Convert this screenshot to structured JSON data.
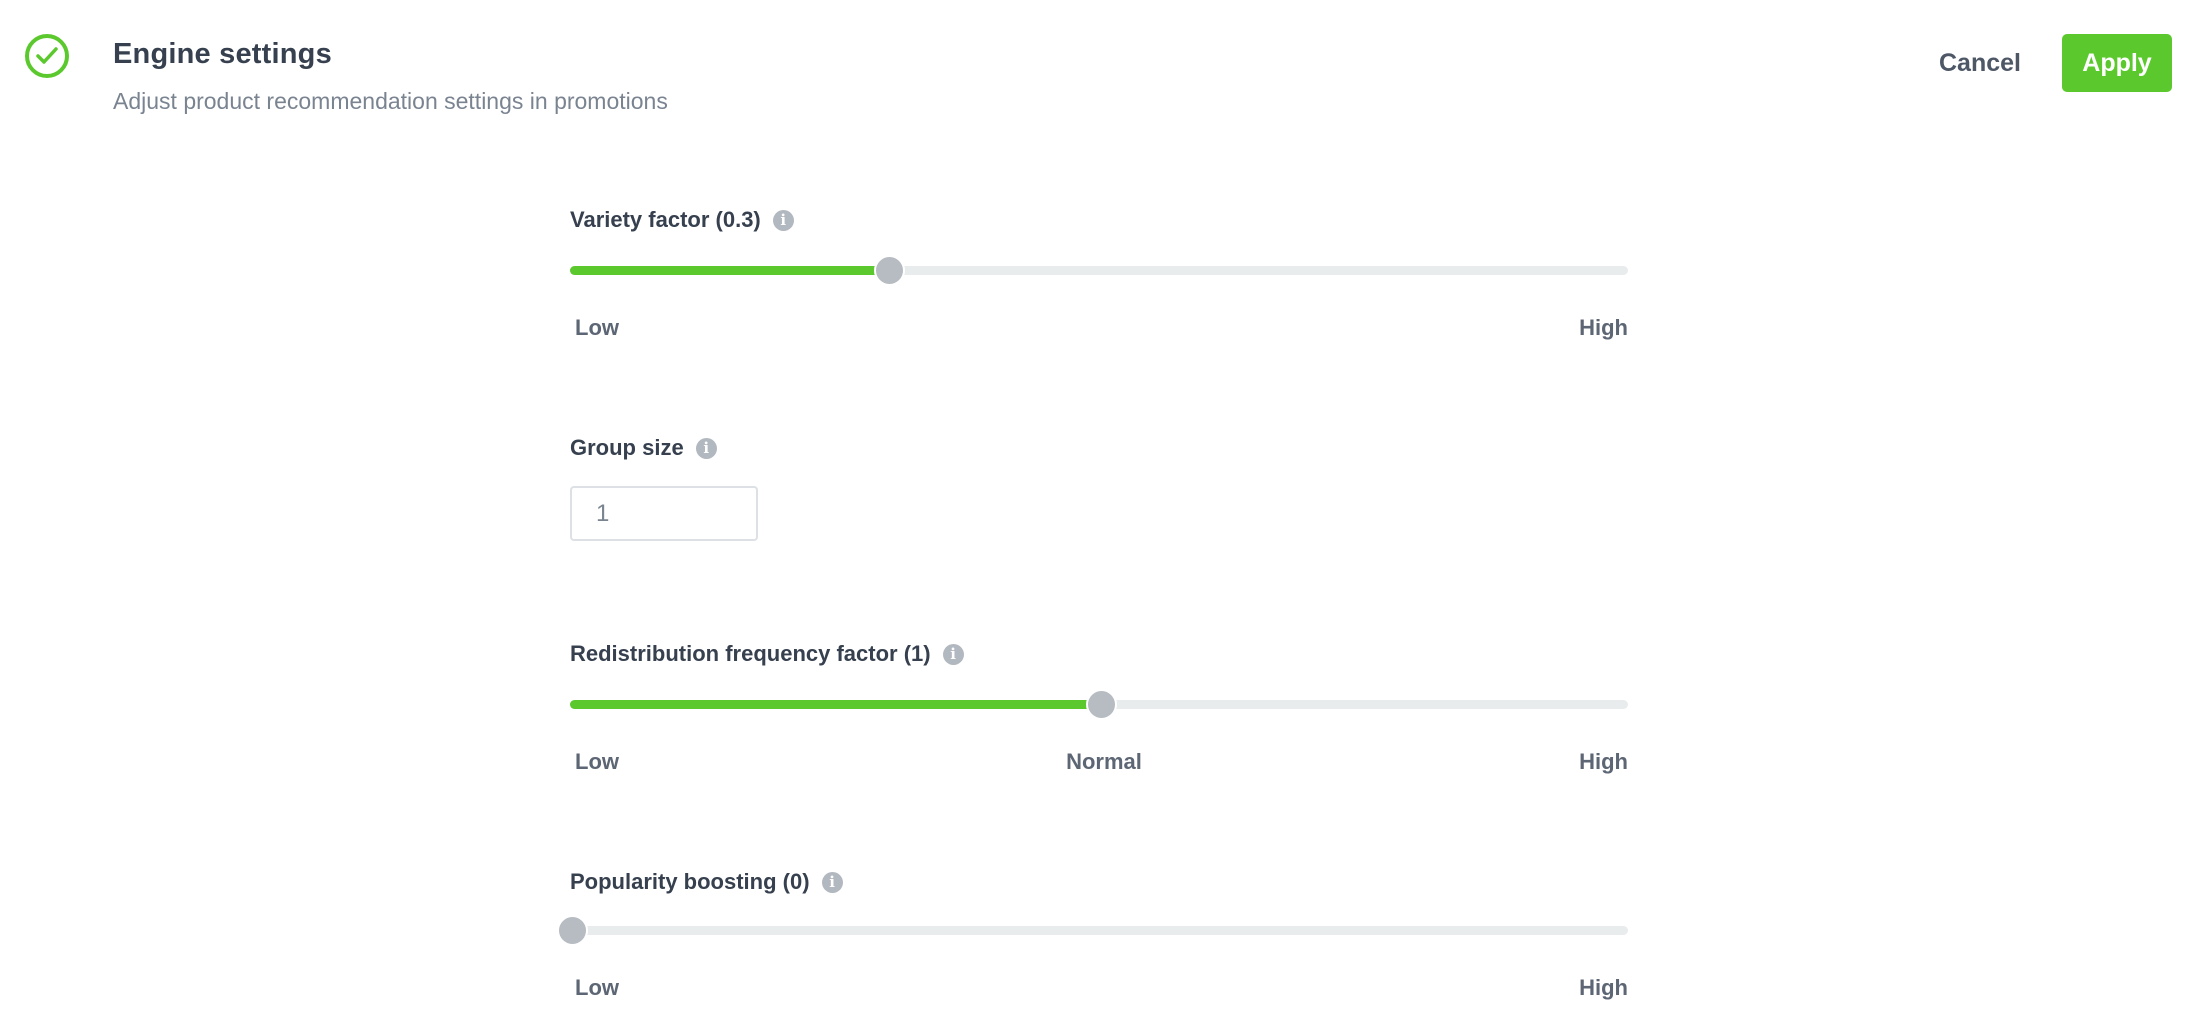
{
  "header": {
    "status_icon": "check-circle-icon",
    "title": "Engine settings",
    "subtitle": "Adjust product recommendation settings in promotions",
    "cancel_label": "Cancel",
    "apply_label": "Apply"
  },
  "colors": {
    "accent": "#5bc92d",
    "track": "#e9ecec",
    "thumb": "#b6bcc2",
    "info": "#b2b8bf",
    "text": "#36404e"
  },
  "settings": {
    "variety": {
      "label": "Variety factor (0.3)",
      "info_icon": "info-icon",
      "value_fraction": 0.3,
      "scale": {
        "low": "Low",
        "high": "High"
      }
    },
    "group_size": {
      "label": "Group size",
      "info_icon": "info-icon",
      "value": "1"
    },
    "redistribution": {
      "label": "Redistribution frequency factor (1)",
      "info_icon": "info-icon",
      "value_fraction": 0.5,
      "scale": {
        "low": "Low",
        "mid": "Normal",
        "high": "High"
      }
    },
    "popularity": {
      "label": "Popularity boosting (0)",
      "info_icon": "info-icon",
      "value_fraction": 0.0,
      "scale": {
        "low": "Low",
        "high": "High"
      }
    }
  }
}
